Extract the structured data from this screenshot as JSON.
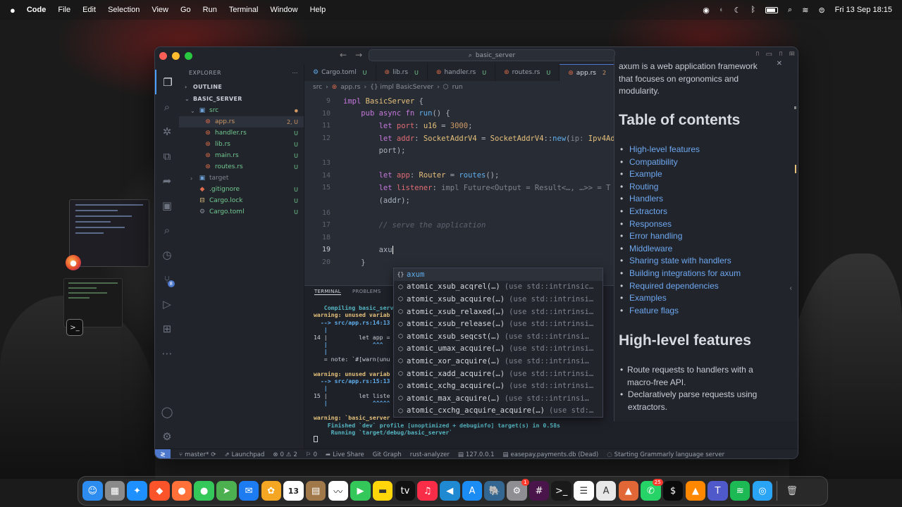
{
  "menubar": {
    "app_name": "Code",
    "items": [
      "File",
      "Edit",
      "Selection",
      "View",
      "Go",
      "Run",
      "Terminal",
      "Window",
      "Help"
    ],
    "datetime": "Fri 13 Sep  18:15"
  },
  "window": {
    "command_center": "basic_server"
  },
  "sidebar": {
    "title": "EXPLORER",
    "outline_label": "OUTLINE",
    "project_label": "BASIC_SERVER",
    "tree": [
      {
        "name": "src",
        "kind": "folder",
        "status": "",
        "depth": 1
      },
      {
        "name": "app.rs",
        "kind": "rust",
        "status": "2, U",
        "depth": 2,
        "selected": true
      },
      {
        "name": "handler.rs",
        "kind": "rust",
        "status": "U",
        "depth": 2
      },
      {
        "name": "lib.rs",
        "kind": "rust",
        "status": "U",
        "depth": 2
      },
      {
        "name": "main.rs",
        "kind": "rust",
        "status": "U",
        "depth": 2
      },
      {
        "name": "routes.rs",
        "kind": "rust",
        "status": "U",
        "depth": 2
      },
      {
        "name": "target",
        "kind": "folder-closed",
        "status": "",
        "depth": 1
      },
      {
        "name": ".gitignore",
        "kind": "git",
        "status": "U",
        "depth": 1
      },
      {
        "name": "Cargo.lock",
        "kind": "lock",
        "status": "U",
        "depth": 1
      },
      {
        "name": "Cargo.toml",
        "kind": "gear",
        "status": "U",
        "depth": 1
      }
    ]
  },
  "editor": {
    "tabs": [
      {
        "label": "Cargo.toml",
        "status": "U",
        "icon": "gear"
      },
      {
        "label": "lib.rs",
        "status": "U",
        "icon": "rust"
      },
      {
        "label": "handler.rs",
        "status": "U",
        "icon": "rust"
      },
      {
        "label": "routes.rs",
        "status": "U",
        "icon": "rust"
      },
      {
        "label": "app.rs",
        "status": "2",
        "icon": "rust",
        "active": true
      }
    ],
    "breadcrumb": [
      "src",
      "app.rs",
      "{} impl BasicServer",
      "run"
    ],
    "line_numbers": [
      "9",
      "10",
      "11",
      "12",
      "",
      "13",
      "14",
      "15",
      "",
      "16",
      "17",
      "18",
      "19",
      "20"
    ],
    "current_line": "19"
  },
  "autocomplete": {
    "items": [
      {
        "label": "axum",
        "detail": "",
        "icon": "{}"
      },
      {
        "label": "atomic_xsub_acqrel(…)",
        "detail": "(use std::intrinsic…"
      },
      {
        "label": "atomic_xsub_acquire(…)",
        "detail": "(use std::intrinsi…"
      },
      {
        "label": "atomic_xsub_relaxed(…)",
        "detail": "(use std::intrinsi…"
      },
      {
        "label": "atomic_xsub_release(…)",
        "detail": "(use std::intrinsi…"
      },
      {
        "label": "atomic_xsub_seqcst(…)",
        "detail": "(use std::intrinsi…"
      },
      {
        "label": "atomic_umax_acquire(…)",
        "detail": "(use std::intrinsi…"
      },
      {
        "label": "atomic_xor_acquire(…)",
        "detail": "(use std::intrinsi…"
      },
      {
        "label": "atomic_xadd_acquire(…)",
        "detail": "(use std::intrinsi…"
      },
      {
        "label": "atomic_xchg_acquire(…)",
        "detail": "(use std::intrinsi…"
      },
      {
        "label": "atomic_max_acquire(…)",
        "detail": "(use std::intrinsi…"
      },
      {
        "label": "atomic_cxchg_acquire_acquire(…)",
        "detail": "(use std:…"
      }
    ]
  },
  "panel": {
    "tabs": [
      "TERMINAL",
      "PROBLEMS"
    ],
    "lines": [
      {
        "cls": "t-green",
        "text": "   Compiling basic_serv"
      },
      {
        "cls": "t-yellow",
        "text": "warning: unused variab"
      },
      {
        "cls": "t-blue",
        "text": "  --> src/app.rs:14:13"
      },
      {
        "cls": "t-blue",
        "text": "   |"
      },
      {
        "cls": "t-white",
        "text": "14 |         let app = "
      },
      {
        "cls": "t-blue",
        "text": "   |             ^^^ "
      },
      {
        "cls": "t-blue",
        "text": "   |"
      },
      {
        "cls": "t-white",
        "text": "   = note: `#[warn(unu"
      },
      {
        "cls": "t-white",
        "text": ""
      },
      {
        "cls": "t-yellow",
        "text": "warning: unused variab"
      },
      {
        "cls": "t-blue",
        "text": "  --> src/app.rs:15:13"
      },
      {
        "cls": "t-blue",
        "text": "   |"
      },
      {
        "cls": "t-white",
        "text": "15 |         let liste"
      },
      {
        "cls": "t-blue",
        "text": "   |             ^^^^^"
      },
      {
        "cls": "t-white",
        "text": ""
      },
      {
        "cls": "t-yellow",
        "text": "warning: `basic_server"
      },
      {
        "cls": "t-green",
        "text": "    Finished `dev` profile [unoptimized + debuginfo] target(s) in 0.58s"
      },
      {
        "cls": "t-green",
        "text": "     Running `target/debug/basic_server`"
      }
    ]
  },
  "statusbar": {
    "branch": "master*",
    "launchpad": "Launchpad",
    "errors": "0",
    "warnings": "2",
    "info": "0",
    "live_share": "Live Share",
    "git_graph": "Git Graph",
    "rust_analyzer": "rust-analyzer",
    "db_host": "127.0.0.1",
    "db_name": "easepay.payments.db (Dead)",
    "grammarly": "Starting Grammarly language server"
  },
  "hover_doc": {
    "intro": "axum is a web application framework that focuses on ergonomics and modularity.",
    "toc_title": "Table of contents",
    "toc": [
      "High-level features",
      "Compatibility",
      "Example",
      "Routing",
      "Handlers",
      "Extractors",
      "Responses",
      "Error handling",
      "Middleware",
      "Sharing state with handlers",
      "Building integrations for axum",
      "Required dependencies",
      "Examples",
      "Feature flags"
    ],
    "features_title": "High-level features",
    "features": [
      "Route requests to handlers with a macro-free API.",
      "Declaratively parse requests using extractors."
    ]
  },
  "dock": {
    "apps": [
      {
        "name": "finder",
        "color": "#2d8cf0",
        "glyph": "☺"
      },
      {
        "name": "launchpad",
        "color": "#8a8a8a",
        "glyph": "▦"
      },
      {
        "name": "safari",
        "color": "#1e90ff",
        "glyph": "✦"
      },
      {
        "name": "brave",
        "color": "#fb542b",
        "glyph": "◆"
      },
      {
        "name": "firefox",
        "color": "#ff7139",
        "glyph": "●"
      },
      {
        "name": "messages",
        "color": "#34c759",
        "glyph": "●"
      },
      {
        "name": "maps",
        "color": "#4caf50",
        "glyph": "➤"
      },
      {
        "name": "mail",
        "color": "#1e7cf2",
        "glyph": "✉"
      },
      {
        "name": "photos",
        "color": "#f5a623",
        "glyph": "✿"
      },
      {
        "name": "calendar",
        "color": "#ffffff",
        "glyph": "13"
      },
      {
        "name": "notes-brown",
        "color": "#a0784a",
        "glyph": "▤"
      },
      {
        "name": "freeform",
        "color": "#ffffff",
        "glyph": "〰"
      },
      {
        "name": "facetime",
        "color": "#34c759",
        "glyph": "▶"
      },
      {
        "name": "notes",
        "color": "#ffd60a",
        "glyph": "▬"
      },
      {
        "name": "apple-tv",
        "color": "#111111",
        "glyph": "tv"
      },
      {
        "name": "music",
        "color": "#fa2d48",
        "glyph": "♫"
      },
      {
        "name": "vscode",
        "color": "#1f8ad2",
        "glyph": "◀"
      },
      {
        "name": "app-store",
        "color": "#1c8cf5",
        "glyph": "A"
      },
      {
        "name": "postgres",
        "color": "#336791",
        "glyph": "🐘"
      },
      {
        "name": "system-settings",
        "color": "#8e8e93",
        "glyph": "⚙"
      },
      {
        "name": "slack",
        "color": "#4a154b",
        "glyph": "#"
      },
      {
        "name": "terminal",
        "color": "#1a1a1a",
        "glyph": ">_"
      },
      {
        "name": "reminders",
        "color": "#ffffff",
        "glyph": "☰"
      },
      {
        "name": "textedit",
        "color": "#e8e8e8",
        "glyph": "A"
      },
      {
        "name": "matlab",
        "color": "#e16737",
        "glyph": "▲"
      },
      {
        "name": "whatsapp",
        "color": "#25d366",
        "glyph": "✆"
      },
      {
        "name": "iterm",
        "color": "#0b0b0b",
        "glyph": "$"
      },
      {
        "name": "vlc",
        "color": "#ff8800",
        "glyph": "▲"
      },
      {
        "name": "teams",
        "color": "#5059c9",
        "glyph": "T"
      },
      {
        "name": "spotify",
        "color": "#1db954",
        "glyph": "≋"
      },
      {
        "name": "browser-extra",
        "color": "#2aa4f4",
        "glyph": "◎"
      }
    ],
    "trash": "trash"
  }
}
